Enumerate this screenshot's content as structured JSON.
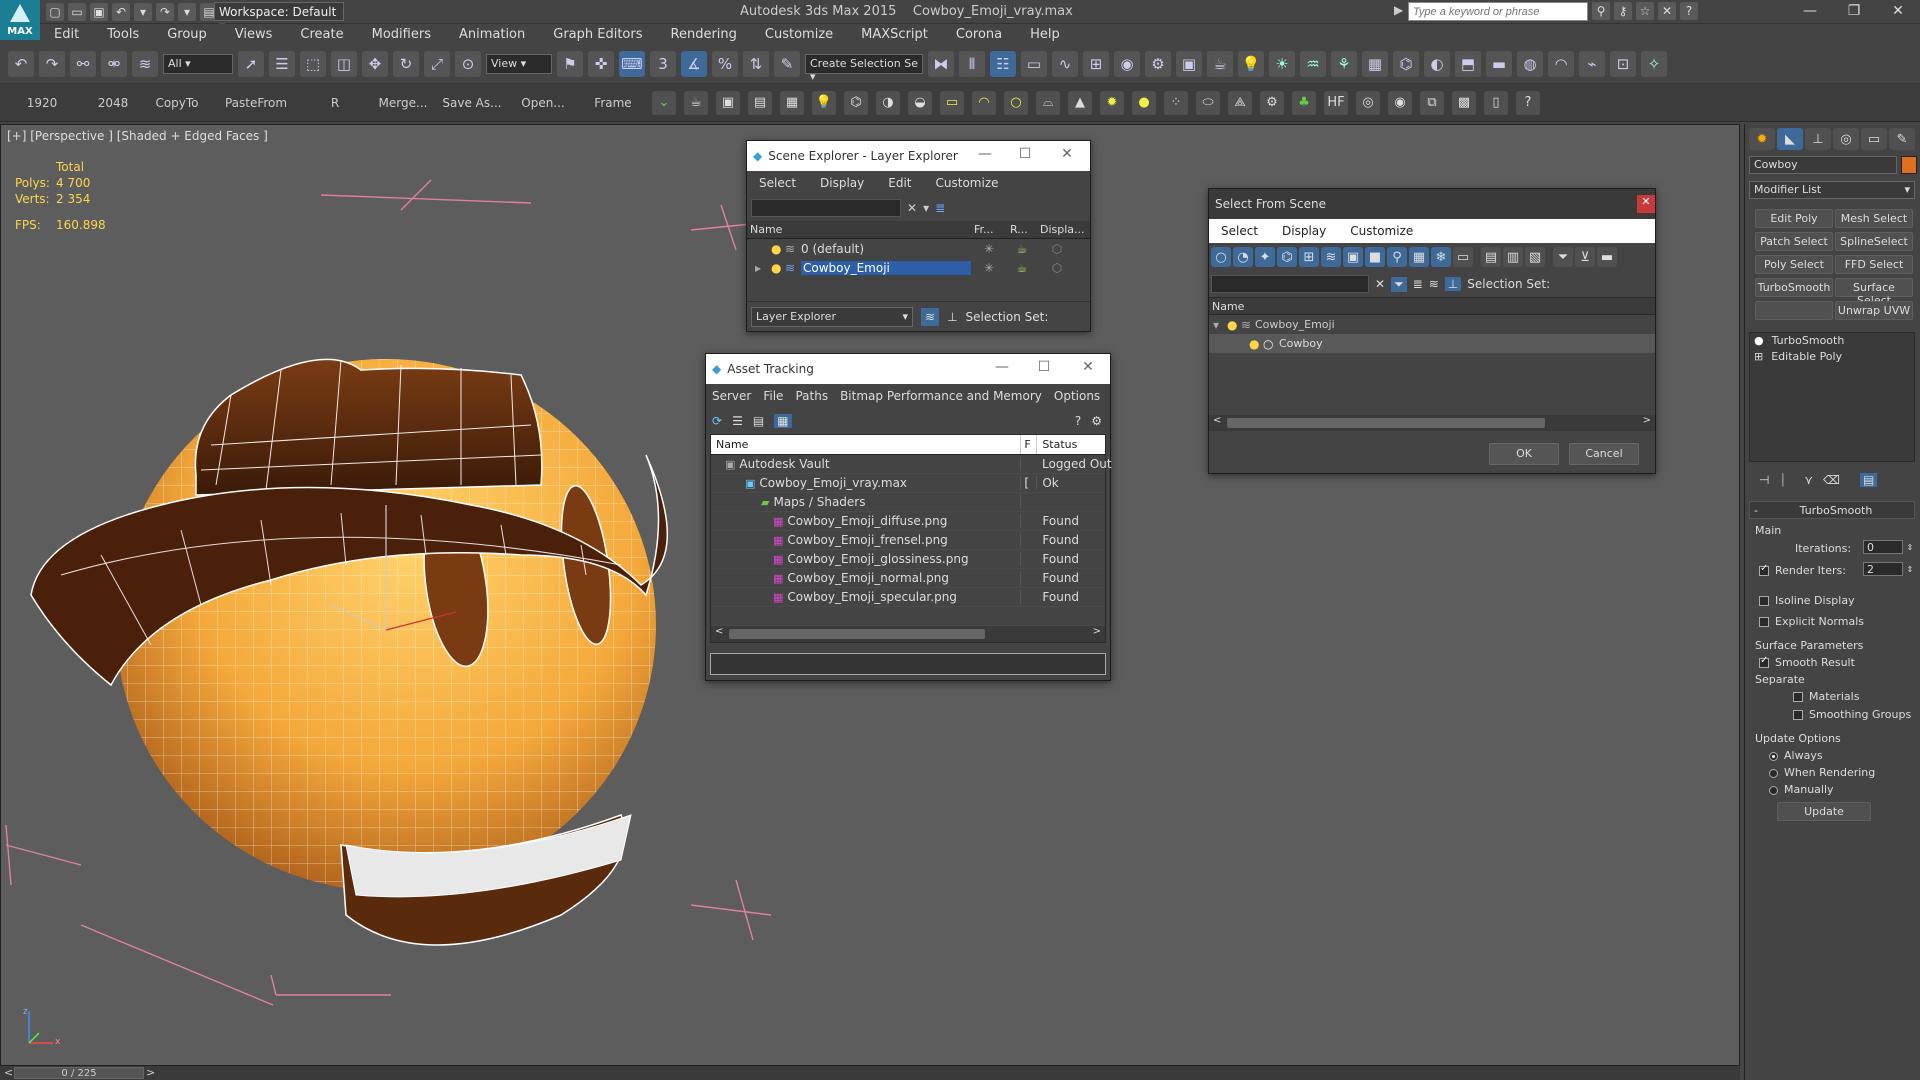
{
  "app": {
    "title": "Autodesk 3ds Max  2015",
    "file": "Cowboy_Emoji_vray.max",
    "workspace": "Workspace: Default",
    "logo_text": "MAX",
    "search_placeholder": "Type a keyword or phrase"
  },
  "menu": [
    "Edit",
    "Tools",
    "Group",
    "Views",
    "Create",
    "Modifiers",
    "Animation",
    "Graph Editors",
    "Rendering",
    "Customize",
    "MAXScript",
    "Corona",
    "Help"
  ],
  "toolbar": {
    "filter": "All",
    "refcoord": "View",
    "selection_set": "Create Selection Se"
  },
  "toolbar2": {
    "labels": [
      "1920",
      "2048",
      "CopyTo",
      "PasteFrom",
      "R",
      "Merge...",
      "Save As...",
      "Open...",
      "Frame"
    ]
  },
  "viewport": {
    "label": "[+] [Perspective ] [Shaded + Edged Faces ]",
    "stats_total": "Total",
    "polys_label": "Polys:",
    "polys_value": "4 700",
    "verts_label": "Verts:",
    "verts_value": "2 354",
    "fps_label": "FPS:",
    "fps_value": "160.898",
    "axis_z": "z",
    "axis_x": "x"
  },
  "timeline": {
    "frame": "0 / 225"
  },
  "layer_explorer": {
    "title": "Scene Explorer - Layer Explorer",
    "menu": [
      "Select",
      "Display",
      "Edit",
      "Customize"
    ],
    "columns": [
      "Name",
      "Fr...",
      "R...",
      "Displa..."
    ],
    "rows": [
      "0 (default)",
      "Cowboy_Emoji"
    ],
    "footer_dropdown": "Layer Explorer",
    "selection_set": "Selection Set:"
  },
  "asset_tracking": {
    "title": "Asset Tracking",
    "menu": [
      "Server",
      "File",
      "Paths",
      "Bitmap Performance and Memory",
      "Options"
    ],
    "columns": [
      "Name",
      "F",
      "Status"
    ],
    "rows": [
      {
        "name": "Autodesk Vault",
        "f": "",
        "status": "Logged Out"
      },
      {
        "name": "Cowboy_Emoji_vray.max",
        "f": "[",
        "status": "Ok"
      },
      {
        "name": "Maps / Shaders",
        "f": "",
        "status": ""
      },
      {
        "name": "Cowboy_Emoji_diffuse.png",
        "f": "",
        "status": "Found"
      },
      {
        "name": "Cowboy_Emoji_frensel.png",
        "f": "",
        "status": "Found"
      },
      {
        "name": "Cowboy_Emoji_glossiness.png",
        "f": "",
        "status": "Found"
      },
      {
        "name": "Cowboy_Emoji_normal.png",
        "f": "",
        "status": "Found"
      },
      {
        "name": "Cowboy_Emoji_specular.png",
        "f": "",
        "status": "Found"
      }
    ]
  },
  "select_from_scene": {
    "title": "Select From Scene",
    "menu": [
      "Select",
      "Display",
      "Customize"
    ],
    "selection_set": "Selection Set:",
    "column": "Name",
    "tree": [
      "Cowboy_Emoji",
      "Cowboy"
    ],
    "ok": "OK",
    "cancel": "Cancel"
  },
  "command_panel": {
    "object_name": "Cowboy",
    "object_color": "#e07020",
    "modifier_list": "Modifier List",
    "buttons": [
      "Edit Poly",
      "Mesh Select",
      "Patch Select",
      "SplineSelect",
      "Poly Select",
      "FFD Select",
      "TurboSmooth",
      "Surface Select",
      "Unwrap UVW"
    ],
    "stack": [
      "TurboSmooth",
      "Editable Poly"
    ],
    "rollout": "TurboSmooth",
    "main": "Main",
    "iterations_label": "Iterations:",
    "iterations_value": "0",
    "render_iters_label": "Render Iters:",
    "render_iters_value": "2",
    "isoline": "Isoline Display",
    "explicit_normals": "Explicit Normals",
    "surface_params": "Surface Parameters",
    "smooth_result": "Smooth Result",
    "separate": "Separate",
    "materials": "Materials",
    "smoothing_groups": "Smoothing Groups",
    "update_options": "Update Options",
    "always": "Always",
    "when_rendering": "When Rendering",
    "manually": "Manually",
    "update": "Update"
  }
}
